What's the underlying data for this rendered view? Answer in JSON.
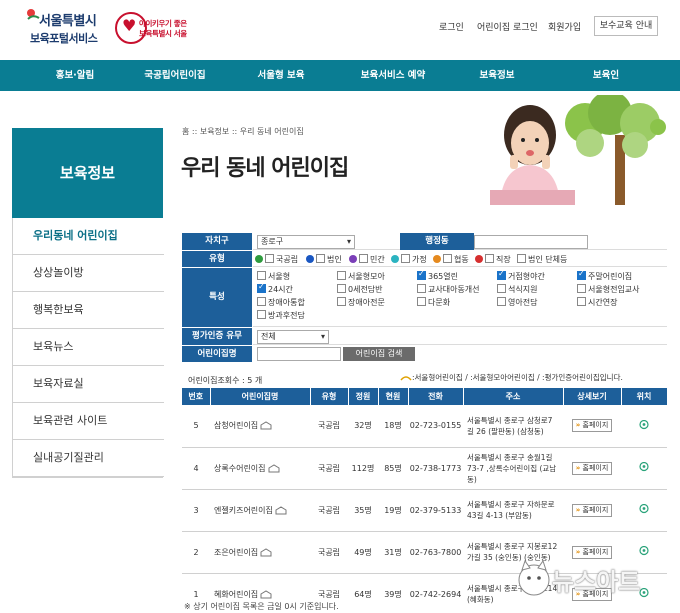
{
  "header": {
    "logo_line1": "서울특별시",
    "logo_line2": "보육포털서비스",
    "badge_line1": "아이키우기 좋은",
    "badge_line2": "보육특별시 서울",
    "utility": [
      "로그인",
      "어린이집 로그인",
      "회원가입"
    ],
    "utility_button": "보수교육 안내"
  },
  "nav": [
    "홍보·알림",
    "국공립어린이집",
    "서울형 보육",
    "보육서비스 예약",
    "보육정보",
    "보육인"
  ],
  "sidebar": {
    "title": "보육정보",
    "items": [
      "우리동네 어린이집",
      "상상놀이방",
      "행복한보육",
      "보육뉴스",
      "보육자료실",
      "보육관련 사이트",
      "실내공기질관리"
    ]
  },
  "breadcrumb": "홈 :: 보육정보 :: 우리 동네 어린이집",
  "page_title": "우리 동네 어린이집",
  "form": {
    "district_label": "자치구",
    "district_value": "종로구",
    "dong_label": "행정동",
    "type_label": "유형",
    "types": [
      {
        "label": "국공립",
        "color": "#2e9b3e",
        "checked": false
      },
      {
        "label": "법인",
        "color": "#1a57c2",
        "checked": false
      },
      {
        "label": "민간",
        "color": "#7b3fb8",
        "checked": false
      },
      {
        "label": "가정",
        "color": "#2bb3c0",
        "checked": false
      },
      {
        "label": "협동",
        "color": "#e58a1f",
        "checked": false
      },
      {
        "label": "직장",
        "color": "#d62f2f",
        "checked": false
      },
      {
        "label": "법인 단체등",
        "color": "",
        "checked": false
      }
    ],
    "feature_label": "특성",
    "features": [
      {
        "label": "서울형",
        "checked": false
      },
      {
        "label": "서울형모아",
        "checked": false
      },
      {
        "label": "365열린",
        "checked": true
      },
      {
        "label": "거점형야간",
        "checked": true
      },
      {
        "label": "주말어린이집",
        "checked": true
      },
      {
        "label": "24시간",
        "checked": true
      },
      {
        "label": "0세전담반",
        "checked": false
      },
      {
        "label": "교사대아동개선",
        "checked": false
      },
      {
        "label": "석식지원",
        "checked": false
      },
      {
        "label": "서울형전임교사",
        "checked": false
      },
      {
        "label": "장애아통합",
        "checked": false
      },
      {
        "label": "장애아전문",
        "checked": false
      },
      {
        "label": "다문화",
        "checked": false
      },
      {
        "label": "영아전담",
        "checked": false
      },
      {
        "label": "시간연장",
        "checked": false
      },
      {
        "label": "방과후전담",
        "checked": false
      }
    ],
    "cert_label": "평가인증 유무",
    "cert_value": "전체",
    "name_label": "어린이집명",
    "search_button": "어린이집 검색"
  },
  "result_count": "어린이집조회수 : 5 개",
  "legend": ":서울형어린이집 / :서울형모아어린이집 / :평가인증어린이집입니다.",
  "table": {
    "headers": [
      "번호",
      "어린이집명",
      "유형",
      "정원",
      "현원",
      "전화",
      "주소",
      "상세보기",
      "위치"
    ],
    "rows": [
      {
        "no": "5",
        "name": "삼청어린이집",
        "type": "국공립",
        "capacity": "32명",
        "current": "18명",
        "phone": "02-723-0155",
        "address": "서울특별시 종로구 삼청로7길 26 (팔판동) (삼청동)"
      },
      {
        "no": "4",
        "name": "상록수어린이집",
        "type": "국공립",
        "capacity": "112명",
        "current": "85명",
        "phone": "02-738-1773",
        "address": "서울특별시 종로구 송월1길 73-7 ,상록수어린이집 (교남동)"
      },
      {
        "no": "3",
        "name": "엔젤키즈어린이집",
        "type": "국공립",
        "capacity": "35명",
        "current": "19명",
        "phone": "02-379-5133",
        "address": "서울특별시 종로구 자하문로43길 4-13 (부암동)"
      },
      {
        "no": "2",
        "name": "조은어린이집",
        "type": "국공립",
        "capacity": "49명",
        "current": "31명",
        "phone": "02-763-7800",
        "address": "서울특별시 종로구 지봉로12가길 35 (숭인동) (숭인동)"
      },
      {
        "no": "1",
        "name": "혜화어린이집",
        "type": "국공립",
        "capacity": "64명",
        "current": "39명",
        "phone": "02-742-2694",
        "address": "서울특별시 종로구 혜화로14 (혜화동)"
      }
    ],
    "detail_button": "홈페이지"
  },
  "footnote": "※ 상기 어린이집 목록은 금일 0시 기준입니다.",
  "watermark": "뉴스아트",
  "colors": {
    "teal": "#0a7d93",
    "table_head": "#1d5f9a",
    "accent_red": "#c8102e"
  }
}
